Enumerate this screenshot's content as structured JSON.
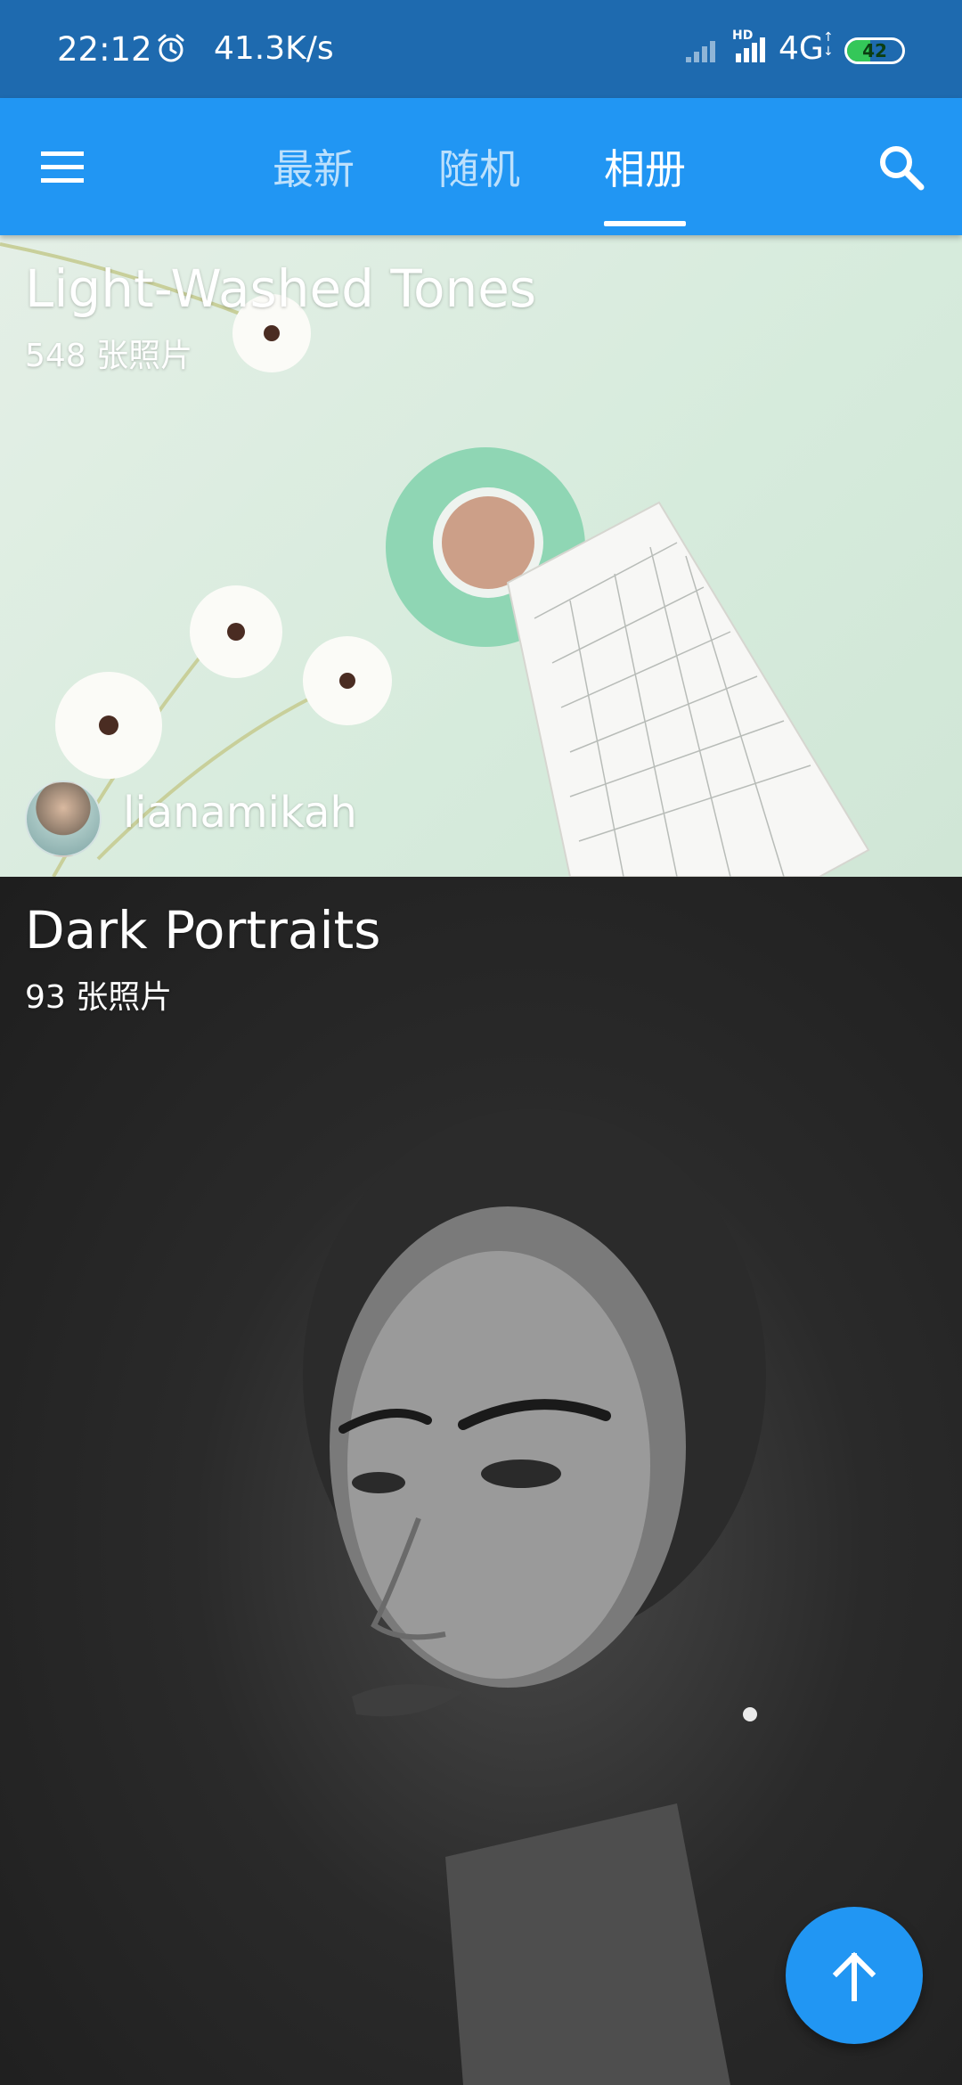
{
  "status_bar": {
    "time": "22:12",
    "net_speed": "41.3K/s",
    "hd_label": "HD",
    "network_type": "4G",
    "battery_level": "42",
    "battery_fraction": 0.42,
    "alarm_icon": "alarm-clock-icon",
    "signal_icon": "signal-bars-icon"
  },
  "app_bar": {
    "menu_icon": "hamburger-menu-icon",
    "search_icon": "search-icon",
    "tabs": [
      {
        "label": "最新",
        "active": false
      },
      {
        "label": "随机",
        "active": false
      },
      {
        "label": "相册",
        "active": true
      }
    ],
    "color": "#2196f3"
  },
  "albums": [
    {
      "title": "Light-Washed Tones",
      "count": "548 张照片",
      "author": "lianamikah"
    },
    {
      "title": "Dark Portraits",
      "count": "93 张照片"
    }
  ],
  "fab": {
    "icon": "arrow-up-icon",
    "color": "#2196f3"
  }
}
